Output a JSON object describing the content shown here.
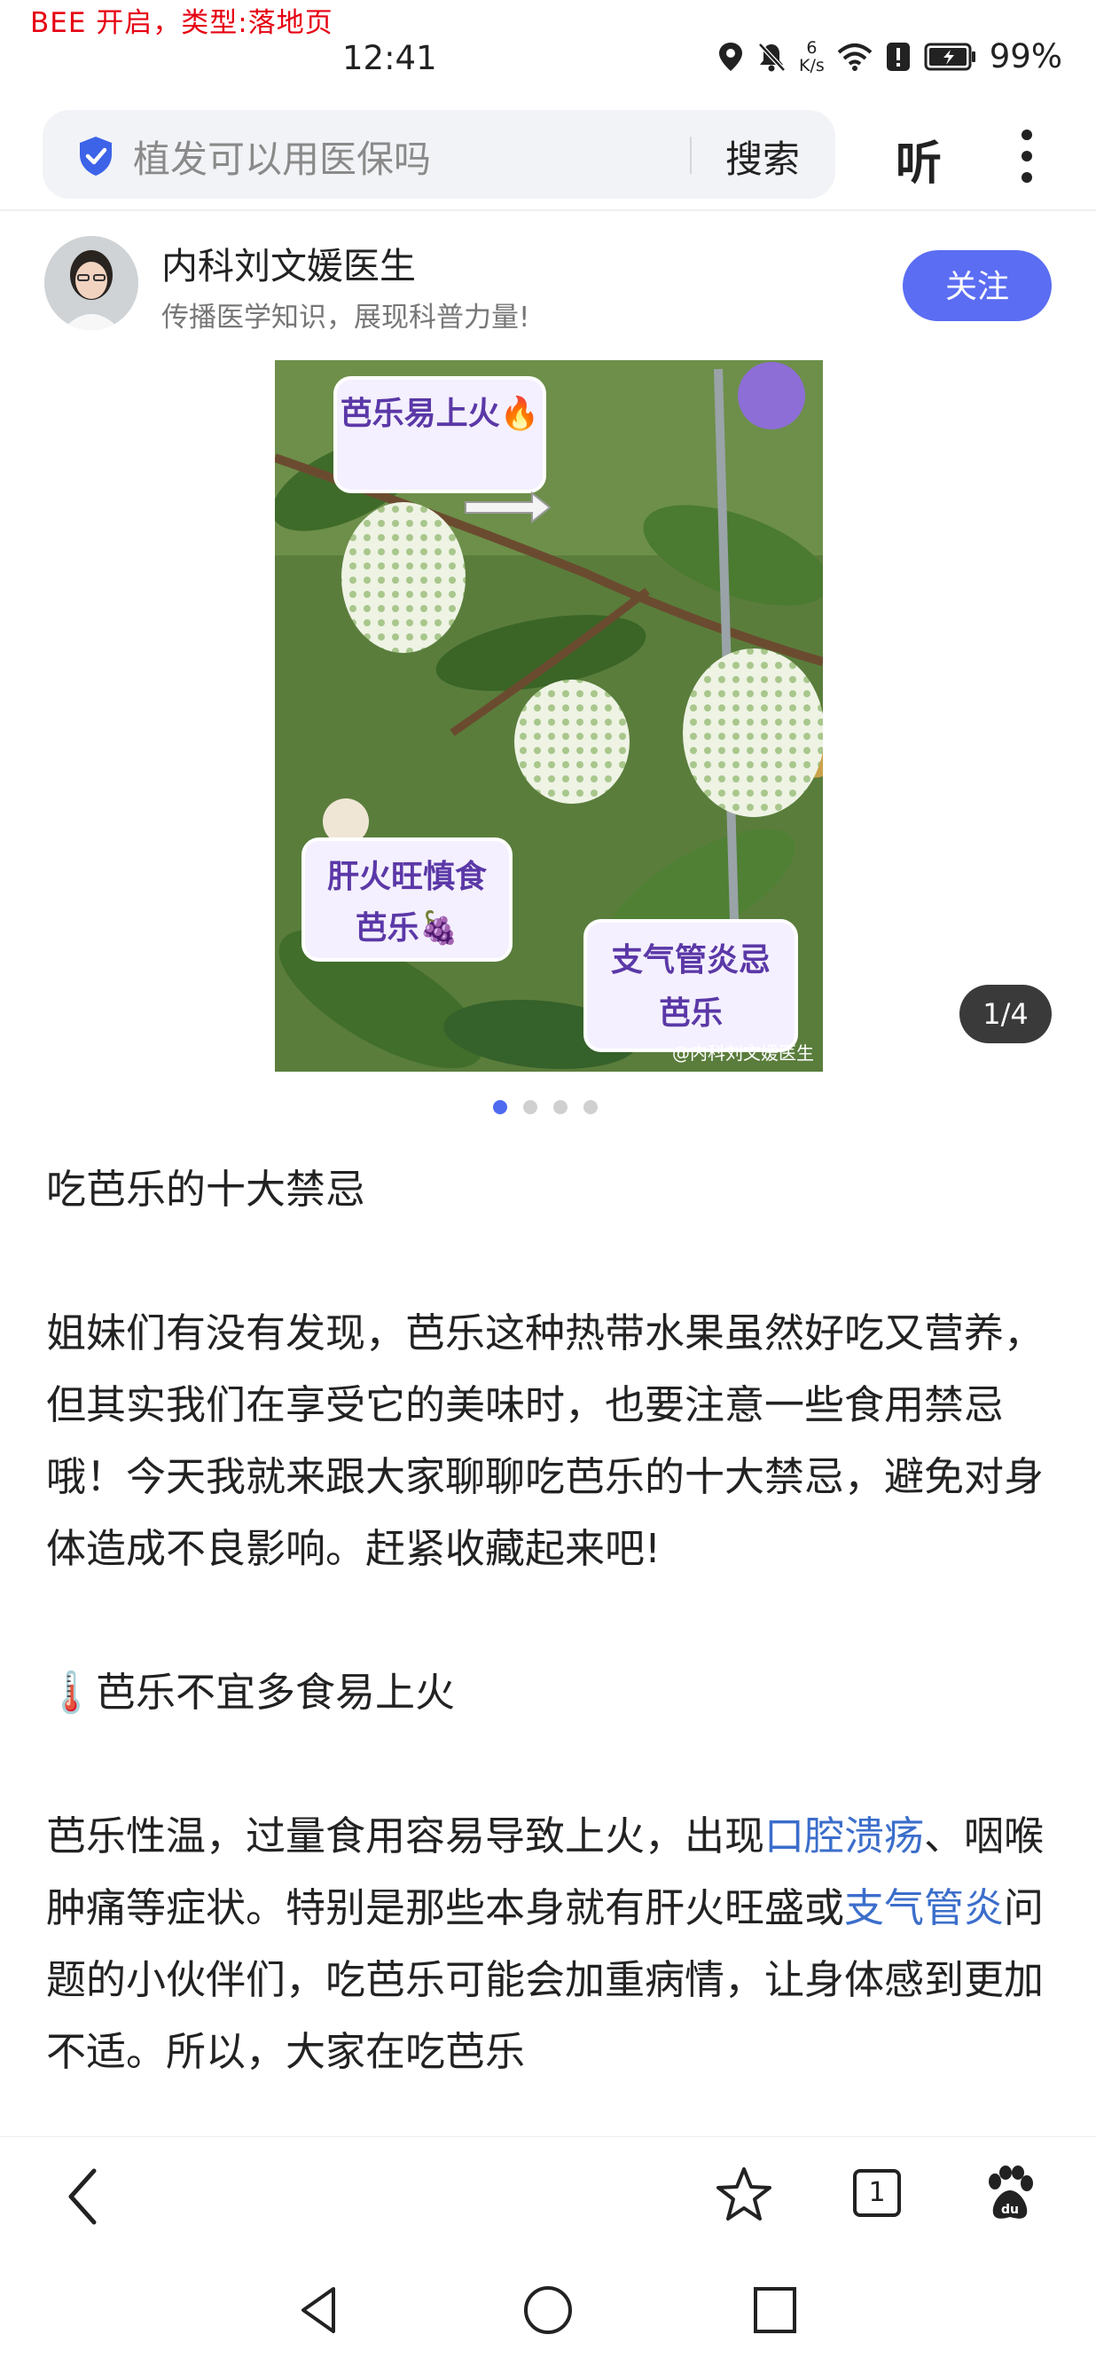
{
  "debug_banner": "BEE 开启，类型:落地页",
  "status_bar": {
    "time": "12:41",
    "net_speed_value": "6",
    "net_speed_unit": "K/s",
    "battery": "99%"
  },
  "search_bar": {
    "query": "植发可以用医保吗",
    "search_button": "搜索",
    "listen_button": "听"
  },
  "author": {
    "name": "内科刘文媛医生",
    "description": "传播医学知识，展现科普力量!",
    "follow_button": "关注"
  },
  "gallery": {
    "counter": "1/4",
    "total": 4,
    "current": 1,
    "labels": {
      "top": "芭乐易上火🔥",
      "left_line1": "肝火旺慎食",
      "left_line2": "芭乐🍇",
      "right_line1": "支气管炎忌",
      "right_line2": "芭乐"
    },
    "watermark": "@内科刘文媛医生"
  },
  "article": {
    "title": "吃芭乐的十大禁忌",
    "intro": "姐妹们有没有发现，芭乐这种热带水果虽然好吃又营养，但其实我们在享受它的美味时，也要注意一些食用禁忌哦！今天我就来跟大家聊聊吃芭乐的十大禁忌，避免对身体造成不良影响。赶紧收藏起来吧!",
    "section1_icon": "🌡️",
    "section1_title": "芭乐不宜多食易上火",
    "para1_a": "芭乐性温，过量食用容易导致上火，出现",
    "para1_link1": "口腔溃疡",
    "para1_b": "、咽喉肿痛等症状。特别是那些本身就有肝火旺盛或",
    "para1_link2": "支气管炎",
    "para1_c": "问题的小伙伴们，吃芭乐可能会加重病情，让身体感到更加不适。所以，大家在吃芭乐"
  },
  "bottom_nav": {
    "tab_count": "1"
  }
}
